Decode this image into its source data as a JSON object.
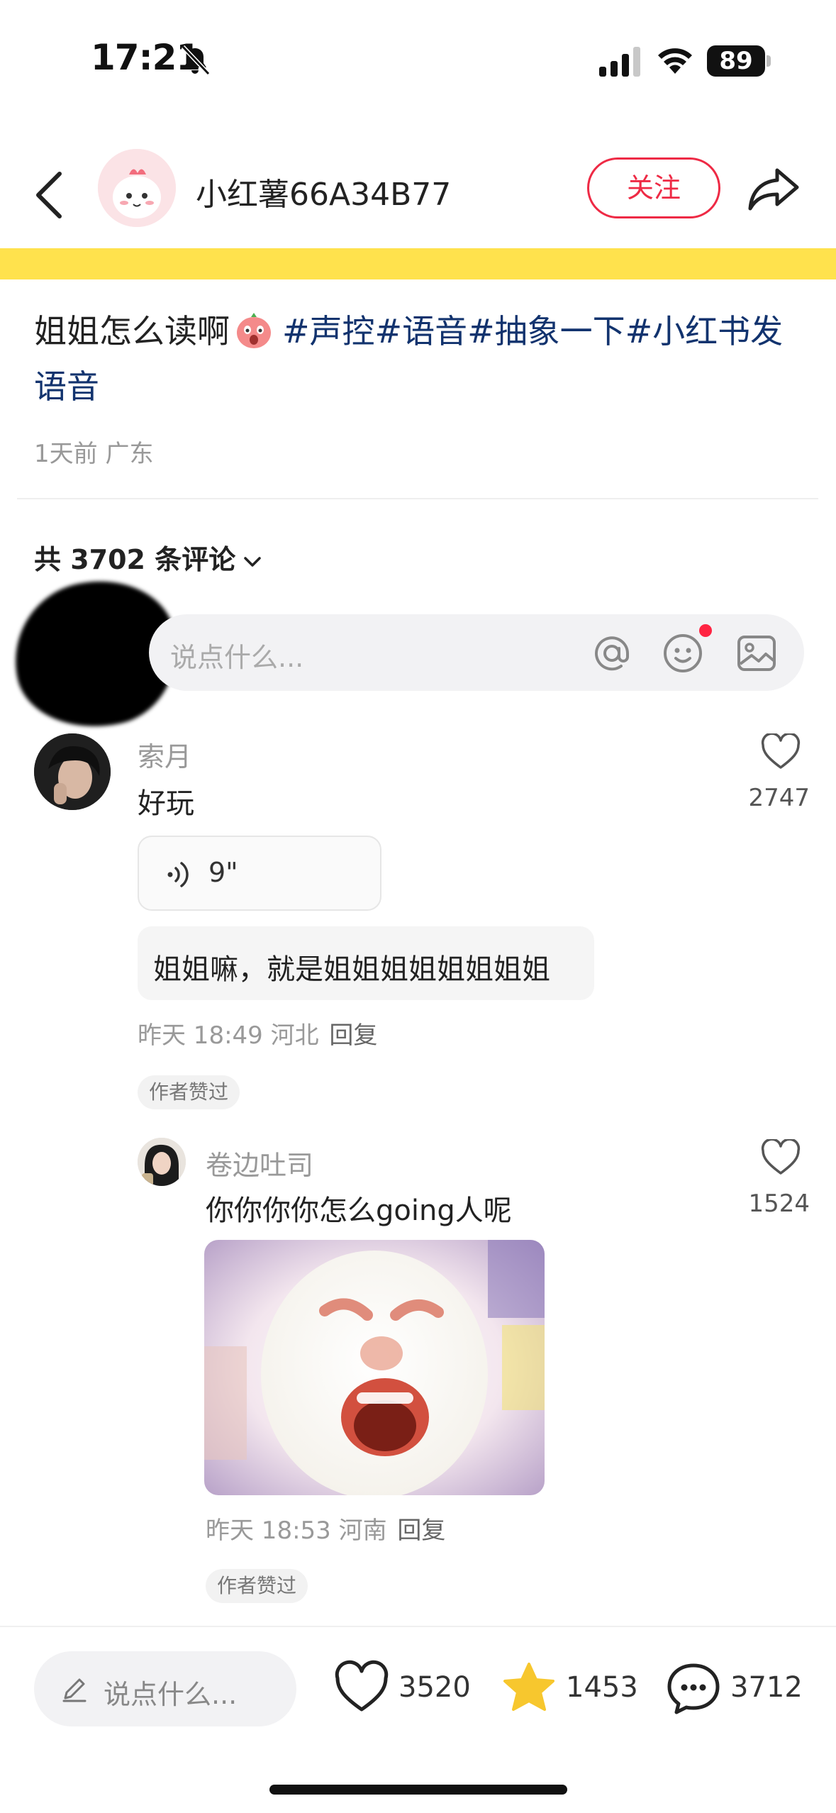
{
  "status_bar": {
    "time": "17:21",
    "battery": "89",
    "icons": [
      "bell-off-icon",
      "cellular-signal-icon",
      "wifi-icon",
      "battery-icon"
    ]
  },
  "header": {
    "author_name": "小红薯66A34B77",
    "follow_label": "关注",
    "icons": [
      "back-arrow-icon",
      "share-icon"
    ]
  },
  "post": {
    "title_text": "姐姐怎么读啊",
    "tags": [
      "#声控",
      "#语音",
      "#抽象一下",
      "#小红书发语音"
    ],
    "meta": "1天前 广东"
  },
  "comments_header": {
    "count_label": "共 3702 条评论"
  },
  "comment_input": {
    "placeholder": "说点什么..."
  },
  "comments": [
    {
      "author": "索月",
      "text": "好玩",
      "likes": "2747",
      "voice_duration": "9\"",
      "transcript": "姐姐嘛，就是姐姐姐姐姐姐姐姐",
      "time_location": "昨天 18:49 河北",
      "reply_label": "回复",
      "badge": "作者赞过",
      "replies": [
        {
          "author": "卷边吐司",
          "text": "你你你你怎么going人呢",
          "likes": "1524",
          "time_location": "昨天 18:53 河南",
          "reply_label": "回复",
          "badge": "作者赞过"
        }
      ]
    }
  ],
  "bottom_bar": {
    "input_placeholder": "说点什么...",
    "likes": "3520",
    "stars": "1453",
    "comments": "3712"
  },
  "colors": {
    "accent": "#ee2a45",
    "tag": "#12336e",
    "banner": "#ffe24d",
    "star": "#f7c72e",
    "notification_dot": "#ff2442"
  }
}
